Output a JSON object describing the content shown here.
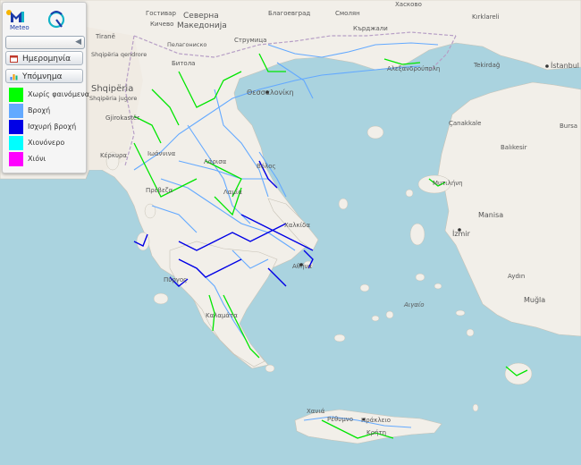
{
  "panel": {
    "logo_text": "Meteo",
    "date_button": "Ημερομηνία",
    "legend_button": "Υπόμνημα",
    "legend": [
      {
        "label": "Χωρίς φαινόμενα",
        "color": "#00ff00"
      },
      {
        "label": "Βροχή",
        "color": "#63a9ff"
      },
      {
        "label": "Ισχυρή βροχή",
        "color": "#0000e6"
      },
      {
        "label": "Χιονόνερο",
        "color": "#00ffff"
      },
      {
        "label": "Χιόνι",
        "color": "#ff00ff"
      }
    ]
  },
  "map_labels": {
    "gostivar": "Гостивар",
    "kichevo": "Кичево",
    "north_macedonia_1": "Северна",
    "north_macedonia_2": "Македонија",
    "blagoevgrad": "Благоевград",
    "smolyan": "Смолян",
    "haskovo": "Хасково",
    "kirklareli": "Kırklareli",
    "tirane": "Tiranë",
    "pelagonia": "Пелагониско",
    "strumica": "Струмица",
    "kardzhali": "Кърджали",
    "shqiperia_qendrore": "Shqipëria qendrore",
    "bitola": "Битола",
    "tekirdag": "Tekirdağ",
    "istanbul": "İstanbul",
    "shqiperia": "Shqipëria",
    "shqiperia_jugore": "Shqipëria jugore",
    "thessaloniki": "Θεσσαλονίκη",
    "alexandroupoli": "Αλεξανδρούπολη",
    "gjirokaster": "Gjirokastër",
    "canakkale": "Çanakkale",
    "bursa": "Bursa",
    "balikesir": "Balıkesir",
    "kerkyra": "Κέρκυρα",
    "ioannina": "Ιωάννινα",
    "larisa": "Λάρισα",
    "volos": "Βόλος",
    "mytilini": "Μυτιλήνη",
    "preveza": "Πρέβεζα",
    "lamia": "Λαμία",
    "chalkida": "Χαλκίδα",
    "manisa": "Manisa",
    "izmir": "İzmir",
    "athina": "Αθήνα",
    "pyrgos": "Πύργος",
    "aydin": "Aydın",
    "aigaio": "Αιγαίο",
    "mugla": "Muğla",
    "kalamata": "Καλαμάτα",
    "chania": "Χανιά",
    "rethymno": "Ρέθυμνο",
    "irakleio": "Ηράκλειο",
    "kriti": "Κρήτη"
  }
}
